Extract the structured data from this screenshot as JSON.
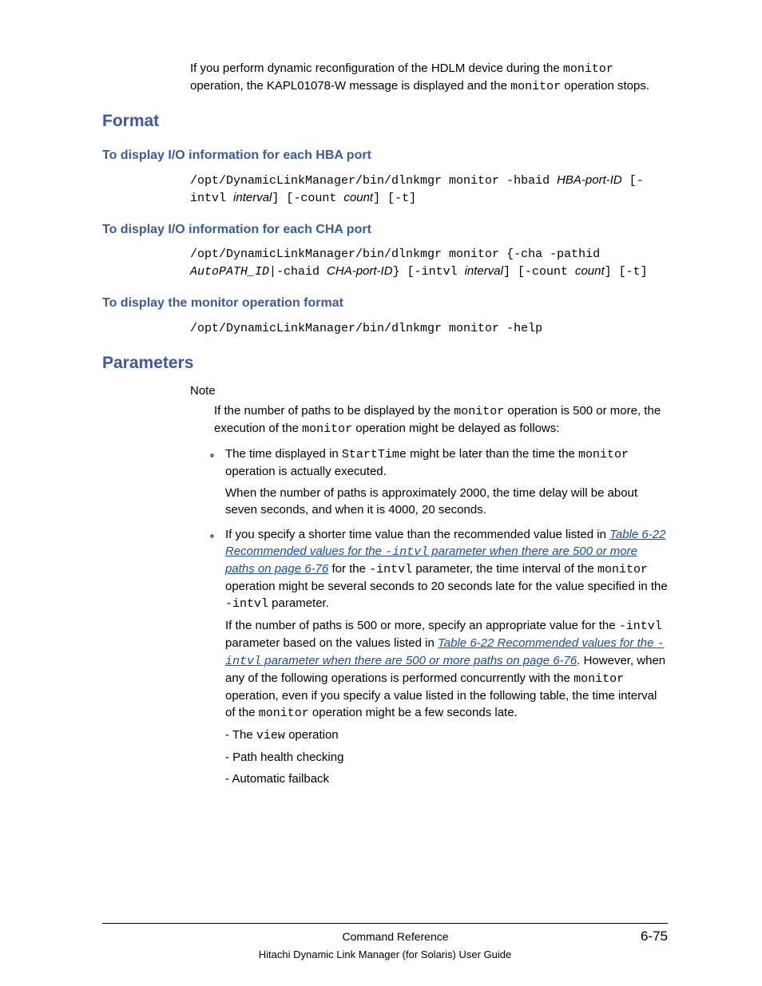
{
  "intro": {
    "p1a": "If you perform dynamic reconfiguration of the HDLM device during the ",
    "p1_code1": "monitor",
    "p1b": " operation, the KAPL01078-W message is displayed and the ",
    "p1_code2": "monitor",
    "p1c": " operation stops."
  },
  "format": {
    "heading": "Format",
    "hba": {
      "heading": "To display I/O information for each HBA port",
      "s1": "/opt/DynamicLinkManager/bin/dlnkmgr monitor -hbaid ",
      "s2": "HBA-port-ID",
      "s3": " [-intvl ",
      "s4": "interval",
      "s5": "] [-count ",
      "s6": "count",
      "s7": "] [-t]"
    },
    "cha": {
      "heading": "To display I/O information for each CHA port",
      "s1": "/opt/DynamicLinkManager/bin/dlnkmgr monitor {-cha -pathid ",
      "s2": "AutoPATH_ID",
      "s3": "|-chaid ",
      "s4": "CHA-port-ID",
      "s5": "} [-intvl ",
      "s6": "interval",
      "s7": "] [-count ",
      "s8": "count",
      "s9": "] [-t]"
    },
    "help": {
      "heading": "To display the monitor operation format",
      "s1": "/opt/DynamicLinkManager/bin/dlnkmgr monitor -help"
    }
  },
  "params": {
    "heading": "Parameters",
    "note_label": "Note",
    "note_body": {
      "a": "If the number of paths to be displayed by the ",
      "c1": "monitor",
      "b": " operation is 500 or more, the execution of the ",
      "c2": "monitor",
      "c": " operation might be delayed as follows:"
    },
    "b1": {
      "p1a": "The time displayed in ",
      "p1c1": "StartTime",
      "p1b": " might be later than the time the ",
      "p1c2": "monitor",
      "p1c": " operation is actually executed.",
      "p2": "When the number of paths is approximately 2000, the time delay will be about seven seconds, and when it is 4000, 20 seconds."
    },
    "b2": {
      "p1a": "If you specify a shorter time value than the recommended value listed in ",
      "link1a": "Table 6-22 Recommended values for the ",
      "link1code": "-intvl",
      "link1b": " parameter when there are 500 or more paths on page 6-76",
      "p1b": " for the ",
      "p1c1": "-intvl",
      "p1c": " parameter, the time interval of the ",
      "p1c2": "monitor",
      "p1d": " operation might be several seconds to 20 seconds late for the value specified in the ",
      "p1c3": "-intvl",
      "p1e": " parameter.",
      "p2a": "If the number of paths is 500 or more, specify an appropriate value for the ",
      "p2c1": "-intvl",
      "p2b": " parameter based on the values listed in ",
      "link2a": "Table 6-22 Recommended values for the ",
      "link2code": "-intvl",
      "link2b": " parameter when there are 500 or more paths on page 6-76",
      "p2c": ". However, when any of the following operations is performed concurrently with the ",
      "p2c2": "monitor",
      "p2d": " operation, even if you specify a value listed in the following table, the time interval of the ",
      "p2c3": "monitor",
      "p2e": " operation might be a few seconds late.",
      "d1a": "- The ",
      "d1c": "view",
      "d1b": " operation",
      "d2": "- Path health checking",
      "d3": "- Automatic failback"
    }
  },
  "footer": {
    "title": "Command Reference",
    "page": "6-75",
    "book": "Hitachi Dynamic Link Manager (for Solaris) User Guide"
  }
}
